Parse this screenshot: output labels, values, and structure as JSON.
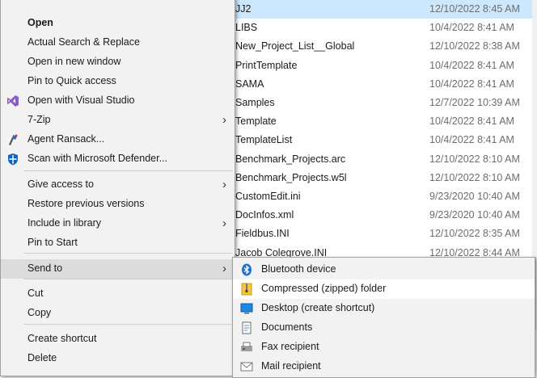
{
  "explorer": {
    "files": [
      {
        "name": "JJ2",
        "date": "12/10/2022 8:45 AM",
        "type": "folder",
        "selected": true
      },
      {
        "name": "LIBS",
        "date": "10/4/2022 8:41 AM",
        "type": "folder"
      },
      {
        "name": "New_Project_List__Global",
        "date": "12/10/2022 8:38 AM",
        "type": "folder"
      },
      {
        "name": "PrintTemplate",
        "date": "10/4/2022 8:41 AM",
        "type": "folder"
      },
      {
        "name": "SAMA",
        "date": "10/4/2022 8:41 AM",
        "type": "folder"
      },
      {
        "name": "Samples",
        "date": "12/7/2022 10:39 AM",
        "type": "folder"
      },
      {
        "name": "Template",
        "date": "10/4/2022 8:41 AM",
        "type": "folder"
      },
      {
        "name": "TemplateList",
        "date": "10/4/2022 8:41 AM",
        "type": "folder"
      },
      {
        "name": "Benchmark_Projects.arc",
        "date": "12/10/2022 8:10 AM",
        "type": "file"
      },
      {
        "name": "Benchmark_Projects.w5l",
        "date": "12/10/2022 8:10 AM",
        "type": "file"
      },
      {
        "name": "CustomEdit.ini",
        "date": "9/23/2020 10:40 AM",
        "type": "file"
      },
      {
        "name": "DocInfos.xml",
        "date": "9/23/2020 10:40 AM",
        "type": "file"
      },
      {
        "name": "Fieldbus.INI",
        "date": "12/10/2022 8:35 AM",
        "type": "file"
      },
      {
        "name": "Jacob Colegrove.INI",
        "date": "12/10/2022 8:44 AM",
        "type": "file"
      }
    ]
  },
  "context_menu": {
    "items": [
      {
        "label": "Open",
        "bold": true,
        "icon": ""
      },
      {
        "label": "Actual Search & Replace",
        "icon": ""
      },
      {
        "label": "Open in new window",
        "icon": ""
      },
      {
        "label": "Pin to Quick access",
        "icon": ""
      },
      {
        "label": "Open with Visual Studio",
        "icon": "visual-studio-icon"
      },
      {
        "label": "7-Zip",
        "icon": "",
        "submenu": true
      },
      {
        "label": "Agent Ransack...",
        "icon": "agent-ransack-icon"
      },
      {
        "label": "Scan with Microsoft Defender...",
        "icon": "defender-shield-icon"
      },
      {
        "label": "Give access to",
        "icon": "",
        "submenu": true
      },
      {
        "label": "Restore previous versions",
        "icon": ""
      },
      {
        "label": "Include in library",
        "icon": "",
        "submenu": true
      },
      {
        "label": "Pin to Start",
        "icon": ""
      },
      {
        "label": "Send to",
        "icon": "",
        "submenu": true,
        "highlight": true
      },
      {
        "label": "Cut",
        "icon": ""
      },
      {
        "label": "Copy",
        "icon": ""
      },
      {
        "label": "Create shortcut",
        "icon": ""
      },
      {
        "label": "Delete",
        "icon": ""
      }
    ],
    "submenu_arrow": "›"
  },
  "sendto_menu": {
    "items": [
      {
        "label": "Bluetooth device",
        "icon": "bluetooth-icon"
      },
      {
        "label": "Compressed (zipped) folder",
        "icon": "zip-folder-icon",
        "highlight": true
      },
      {
        "label": "Desktop (create shortcut)",
        "icon": "desktop-icon"
      },
      {
        "label": "Documents",
        "icon": "documents-icon"
      },
      {
        "label": "Fax recipient",
        "icon": "fax-icon"
      },
      {
        "label": "Mail recipient",
        "icon": "mail-icon"
      }
    ]
  },
  "colors": {
    "selection": "#cce8ff",
    "menu_bg": "#f2f2f2",
    "menu_highlight": "#dcdcdc",
    "folder": "#f2c94c"
  }
}
